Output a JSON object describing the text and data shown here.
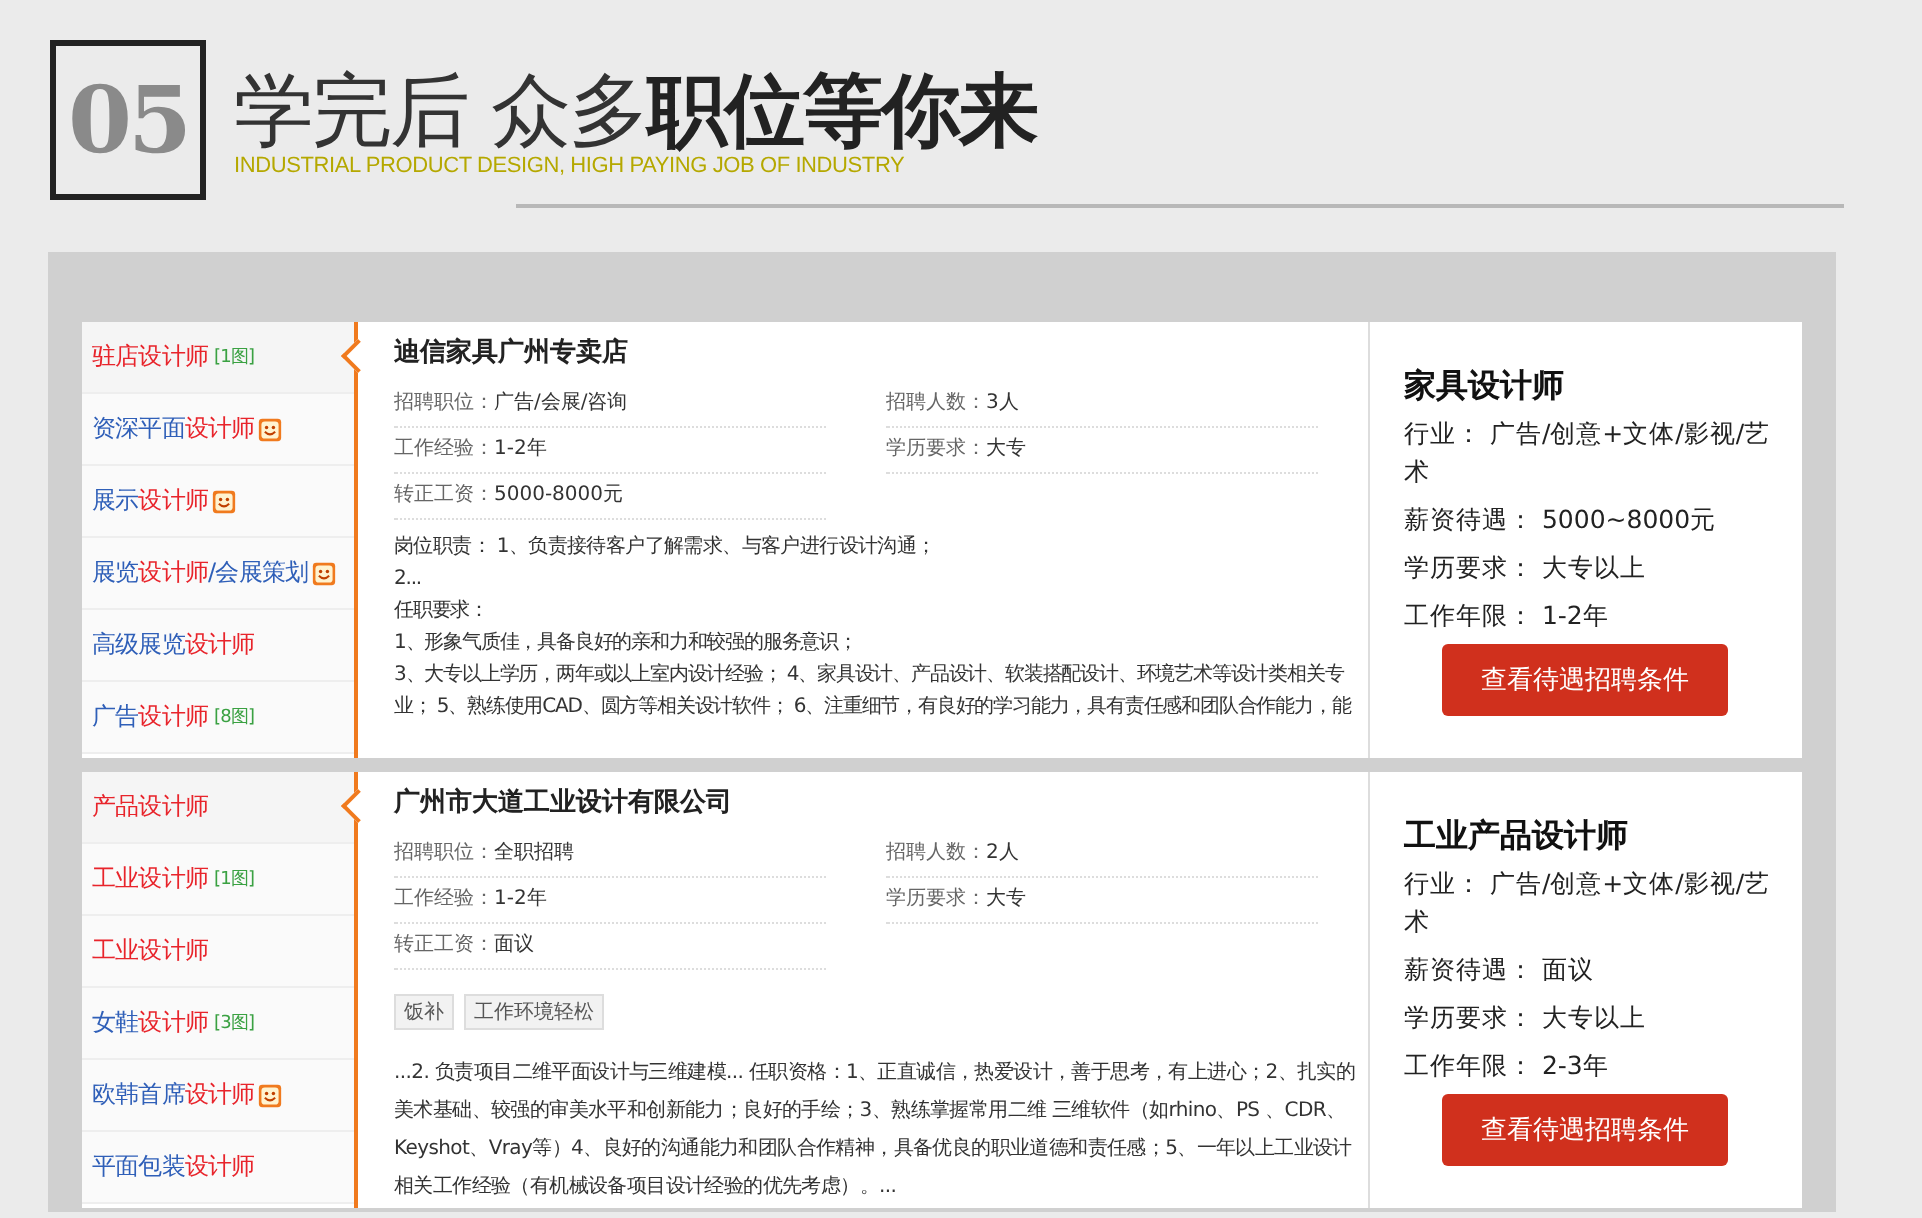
{
  "header": {
    "number": "05",
    "title": "学完后 众多**职位等你来**",
    "subtitle": "INDUSTRIAL PRODUCT DESIGN, HIGH PAYING JOB OF INDUSTRY"
  },
  "cards": [
    {
      "sidebar": [
        {
          "parts": [
            {
              "text": "驻店设计师",
              "highlight": true
            }
          ],
          "badge": "[1图]",
          "smiley": false,
          "selected": true
        },
        {
          "parts": [
            {
              "text": "资深平面",
              "highlight": false
            },
            {
              "text": "设计师",
              "highlight": true
            }
          ],
          "smiley": true,
          "selected": false
        },
        {
          "parts": [
            {
              "text": "展示",
              "highlight": false
            },
            {
              "text": "设计师",
              "highlight": true
            }
          ],
          "smiley": true,
          "selected": false
        },
        {
          "parts": [
            {
              "text": "展览",
              "highlight": false
            },
            {
              "text": "设计师",
              "highlight": true
            },
            {
              "text": "/会展策划",
              "highlight": false
            }
          ],
          "smiley": true,
          "selected": false
        },
        {
          "parts": [
            {
              "text": "高级展览",
              "highlight": false
            },
            {
              "text": "设计师",
              "highlight": true
            }
          ],
          "smiley": false,
          "selected": false
        },
        {
          "parts": [
            {
              "text": "广告",
              "highlight": false
            },
            {
              "text": "设计师",
              "highlight": true
            }
          ],
          "badge": "[8图]",
          "smiley": false,
          "selected": false
        }
      ],
      "company": "迪信家具广州专卖店",
      "fields": [
        {
          "label": "招聘职位：",
          "value": "广告/会展/咨询"
        },
        {
          "label": "招聘人数：",
          "value": "3人"
        },
        {
          "label": "工作经验：",
          "value": "1-2年"
        },
        {
          "label": "学历要求：",
          "value": "大专"
        },
        {
          "label": "转正工资：",
          "value": "5000-8000元"
        }
      ],
      "description": [
        "岗位职责： 1、负责接待客户了解需求、与客户进行设计沟通；",
        "2...",
        "任职要求：",
        "1、形象气质佳，具备良好的亲和力和较强的服务意识；",
        "3、大专以上学历，两年或以上室内设计经验； 4、家具设计、产品设计、软装搭配设计、环境艺术等设计类相关专业； 5、熟练使用CAD、圆方等相关设计软件； 6、注重细节，有良好的学习能力，具有责任感和团队合作能力，能"
      ],
      "job_title": "家具设计师",
      "details": [
        {
          "label": "行业：",
          "value": "广告/创意+文体/影视/艺术"
        },
        {
          "label": "薪资待遇：",
          "value": "5000~8000元"
        },
        {
          "label": "学历要求：",
          "value": "大专以上"
        },
        {
          "label": "工作年限：",
          "value": "1-2年"
        }
      ],
      "button": "查看待遇招聘条件"
    },
    {
      "sidebar": [
        {
          "parts": [
            {
              "text": "产品设计师",
              "highlight": true
            }
          ],
          "smiley": false,
          "selected": true
        },
        {
          "parts": [
            {
              "text": "工业设计师",
              "highlight": true
            }
          ],
          "badge": "[1图]",
          "smiley": false,
          "selected": false
        },
        {
          "parts": [
            {
              "text": "工业设计师",
              "highlight": true
            }
          ],
          "smiley": false,
          "selected": false
        },
        {
          "parts": [
            {
              "text": "女鞋",
              "highlight": false
            },
            {
              "text": "设计师",
              "highlight": true
            }
          ],
          "badge": "[3图]",
          "smiley": false,
          "selected": false
        },
        {
          "parts": [
            {
              "text": "欧韩首席",
              "highlight": false
            },
            {
              "text": "设计师",
              "highlight": true
            }
          ],
          "smiley": true,
          "selected": false
        },
        {
          "parts": [
            {
              "text": "平面包装",
              "highlight": false
            },
            {
              "text": "设计师",
              "highlight": true
            }
          ],
          "smiley": false,
          "selected": false
        }
      ],
      "company": "广州市大道工业设计有限公司",
      "fields": [
        {
          "label": "招聘职位：",
          "value": "全职招聘"
        },
        {
          "label": "招聘人数：",
          "value": "2人"
        },
        {
          "label": "工作经验：",
          "value": "1-2年"
        },
        {
          "label": "学历要求：",
          "value": "大专"
        },
        {
          "label": "转正工资：",
          "value": "面议"
        }
      ],
      "tags": [
        "饭补",
        "工作环境轻松"
      ],
      "description": [
        "...2. 负责项目二维平面设计与三维建模... 任职资格：1、正直诚信，热爱设计，善于思考，有上进心；2、扎实的美术基础、较强的审美水平和创新能力；良好的手绘；3、熟练掌握常用二维 三维软件（如rhino、PS 、CDR、Keyshot、Vray等）4、良好的沟通能力和团队合作精神，具备优良的职业道德和责任感；5、一年以上工业设计相关工作经验（有机械设备项目设计经验的优先考虑）。..."
      ],
      "job_title": "工业产品设计师",
      "details": [
        {
          "label": "行业：",
          "value": "广告/创意+文体/影视/艺术"
        },
        {
          "label": "薪资待遇：",
          "value": "面议"
        },
        {
          "label": "学历要求：",
          "value": "大专以上"
        },
        {
          "label": "工作年限：",
          "value": "2-3年"
        }
      ],
      "button": "查看待遇招聘条件"
    }
  ]
}
